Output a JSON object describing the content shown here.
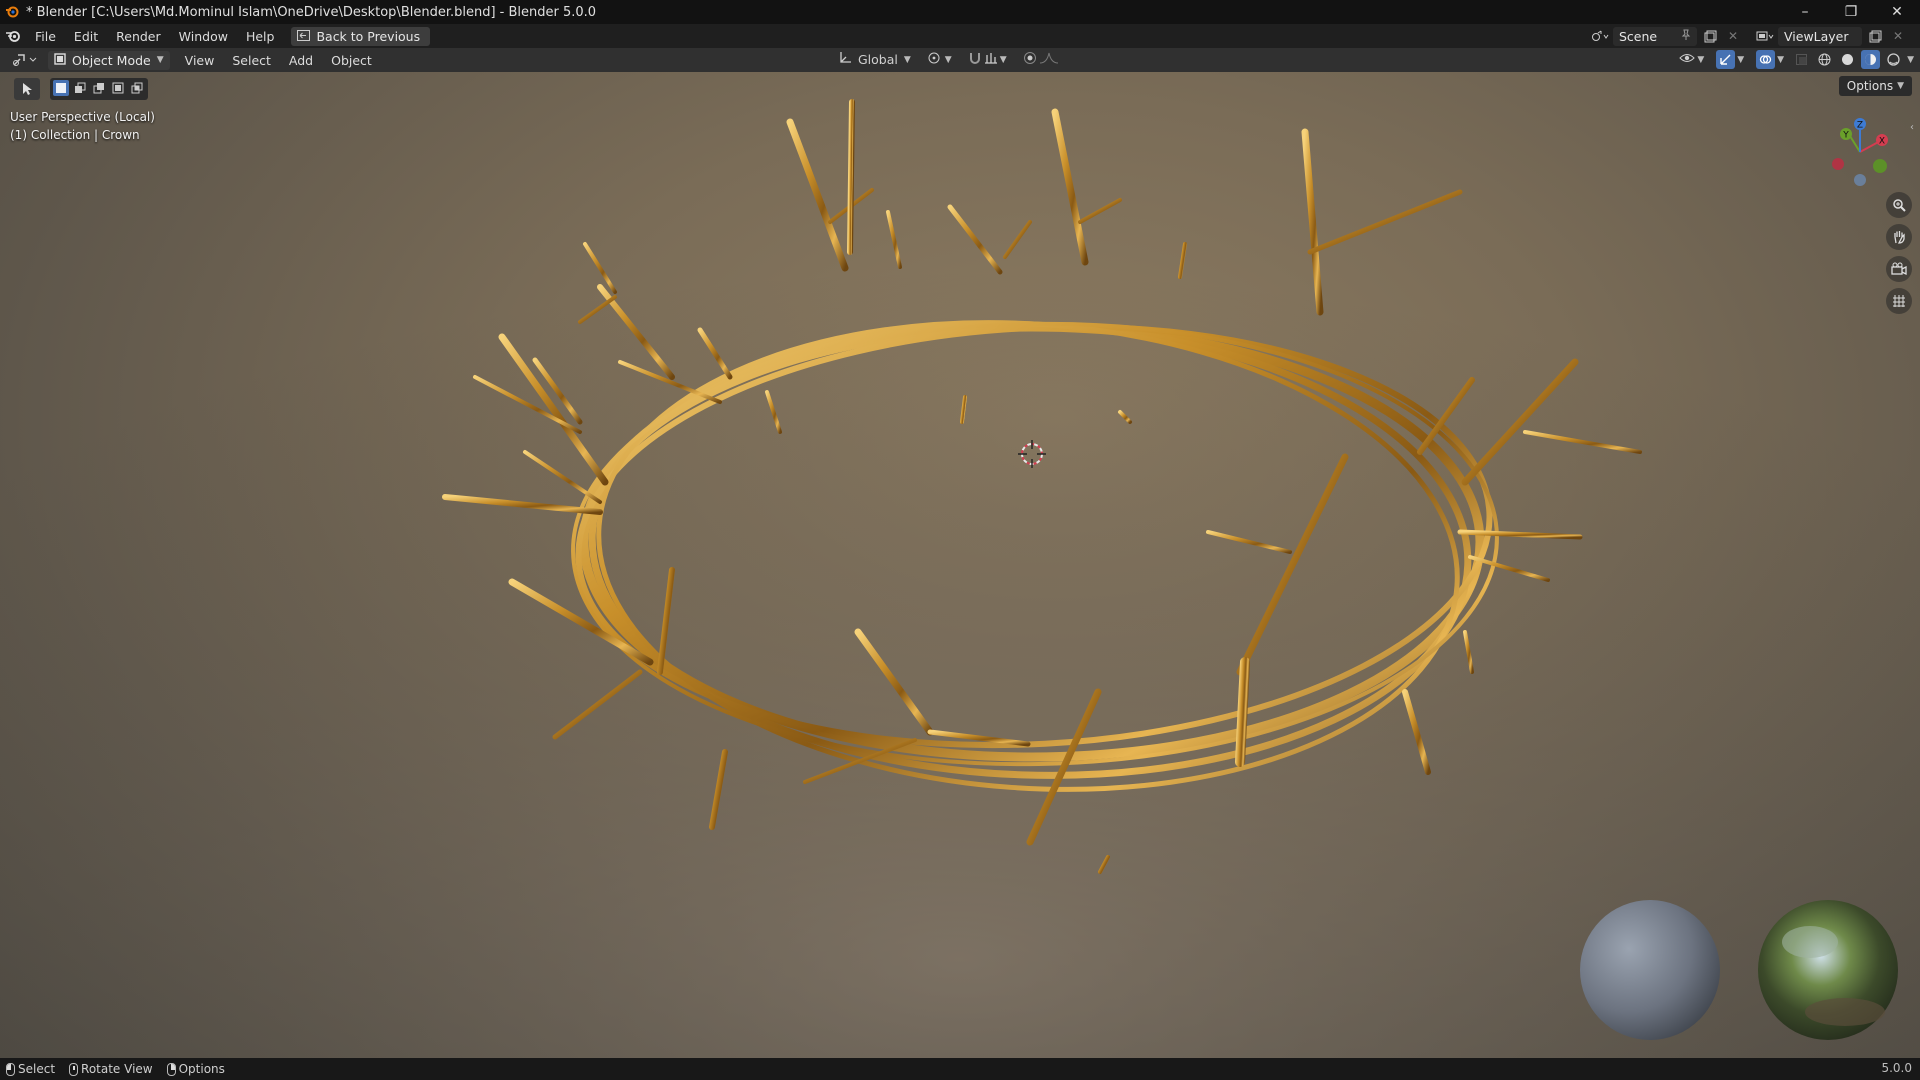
{
  "window": {
    "title": "* Blender [C:\\Users\\Md.Mominul Islam\\OneDrive\\Desktop\\Blender.blend] - Blender 5.0.0",
    "controls": [
      "–",
      "❐",
      "✕"
    ]
  },
  "menubar": {
    "items": [
      "File",
      "Edit",
      "Render",
      "Window",
      "Help"
    ],
    "back_button": "Back to Previous",
    "scene": "Scene",
    "view_layer": "ViewLayer"
  },
  "viewport_header": {
    "mode": "Object Mode",
    "menus": [
      "View",
      "Select",
      "Add",
      "Object"
    ],
    "transform_orientation": "Global",
    "active_shading": "material-preview"
  },
  "viewport": {
    "perspective_label": "User Perspective (Local)",
    "collection_label": "(1) Collection | Crown",
    "options_label": "Options",
    "gizmo_axes": [
      "X",
      "Y",
      "Z"
    ],
    "nav_tools": [
      "zoom-icon",
      "pan-hand-icon",
      "camera-view-icon",
      "ortho-grid-icon"
    ],
    "object": "Crown of thorns (gold)"
  },
  "statusbar": {
    "select": "Select",
    "rotate_view": "Rotate View",
    "options": "Options",
    "version": "5.0.0"
  },
  "colors": {
    "accent": "#4772b3",
    "gold": "#c9962e",
    "axis_x": "#d43d50",
    "axis_y": "#6aa02a",
    "axis_z": "#3d7bd4"
  }
}
